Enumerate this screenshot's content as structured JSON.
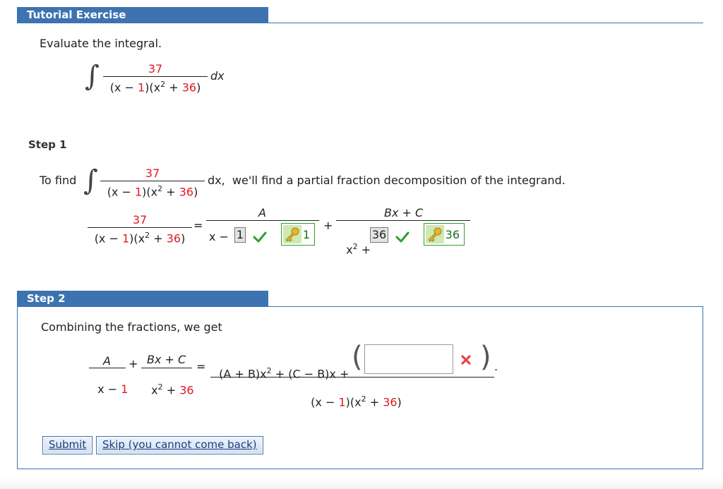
{
  "tutorial": {
    "header": "Tutorial Exercise",
    "prompt": "Evaluate the integral."
  },
  "integral": {
    "numerator": "37",
    "den_a": "(x − ",
    "den_b": "1",
    "den_c": ")(x",
    "den_d": "2",
    "den_e": " + ",
    "den_f": "36",
    "den_g": ")",
    "dx": "dx"
  },
  "step1": {
    "label": "Step 1",
    "to_find": "To find",
    "sentence": "dx,  we'll find a partial fraction decomposition of the integrand.",
    "equals": "=",
    "plus": "+",
    "frac1_num": "A",
    "frac1_den_prefix": "x − ",
    "frac1_answer": "1",
    "frac1_key": "1",
    "frac2_num": "Bx + C",
    "frac2_den_prefix": "x",
    "frac2_den_sup": "2",
    "frac2_den_plus": " + ",
    "frac2_answer": "36",
    "frac2_key": "36"
  },
  "step2": {
    "label": "Step 2",
    "intro": "Combining the fractions, we get",
    "f1_num": "A",
    "f1_den_a": "x − ",
    "f1_den_b": "1",
    "plus": "+",
    "f2_num": "Bx + C",
    "f2_den_a": "x",
    "f2_den_sup": "2",
    "f2_den_b": " + ",
    "f2_den_c": "36",
    "equals": "=",
    "rhs_num_a": "(A + B)x",
    "rhs_num_sup": "2",
    "rhs_num_b": " + (C − B)x + ",
    "input_value": "",
    "period": ".",
    "rhs_den_a": "(x − ",
    "rhs_den_b": "1",
    "rhs_den_c": ")(x",
    "rhs_den_sup": "2",
    "rhs_den_d": " + ",
    "rhs_den_e": "36",
    "rhs_den_f": ")"
  },
  "buttons": {
    "submit": "Submit",
    "skip": "Skip (you cannot come back)"
  },
  "colors": {
    "accent": "#3c73b0",
    "highlight_red": "#e0181f",
    "correct_green": "#2f9d2f",
    "wrong_red": "#e8433f"
  }
}
